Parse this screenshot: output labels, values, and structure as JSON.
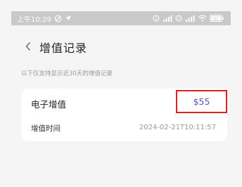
{
  "status_bar": {
    "time": "上午10:29",
    "battery_level": "85",
    "icons": [
      "no-disturb-icon",
      "location-arrow-icon",
      "sim1-icon",
      "signal1-icon",
      "sim2-icon",
      "signal2-icon",
      "wifi-icon",
      "battery-icon"
    ]
  },
  "nav": {
    "back_icon": "chevron-left-icon",
    "title": "增值记录"
  },
  "notice": "以下仅支持显示近30天的增值记录",
  "records": [
    {
      "title": "电子增值",
      "amount": "$55",
      "time_label": "增值时间",
      "time_value": "2024-02-21T10:11:57"
    }
  ],
  "colors": {
    "page_bg": "#f5f5f5",
    "card_bg": "#ffffff",
    "amount": "#6d4bcf",
    "highlight_border": "#e02020",
    "status_bar_bg": "#c9c9c9"
  }
}
